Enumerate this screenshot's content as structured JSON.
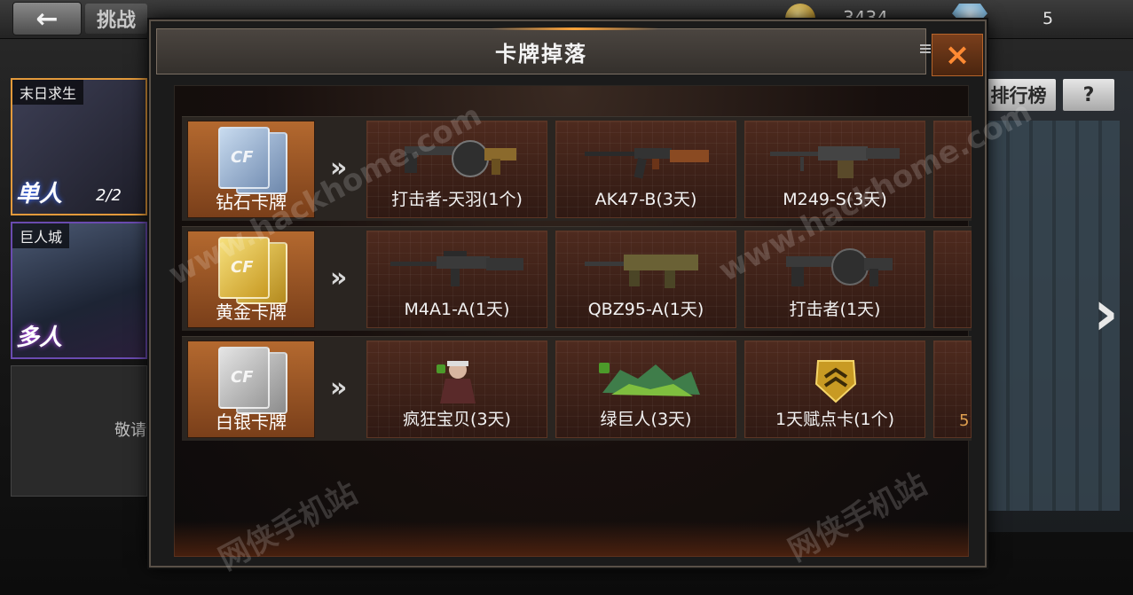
{
  "topbar": {
    "back_icon": "←",
    "challenge_label": "挑战",
    "gold_value": "3434",
    "gem_value": "5"
  },
  "left": {
    "modes": [
      {
        "tag": "末日求生",
        "big": "单人",
        "count": "2/2"
      },
      {
        "tag": "巨人城",
        "big": "多人"
      },
      {
        "hint": "敬请"
      }
    ]
  },
  "right": {
    "rank_label": "排行榜",
    "help_label": "?",
    "next_icon": "›"
  },
  "dialog": {
    "title": "卡牌掉落",
    "close_label": "×",
    "rows": [
      {
        "card_label": "钻石卡牌",
        "card_color": "#9fb8d8",
        "arrow": "»",
        "items": [
          "打击者-天羽(1个)",
          "AK47-B(3天)",
          "M249-S(3天)"
        ]
      },
      {
        "card_label": "黄金卡牌",
        "card_color": "#e7c24a",
        "arrow": "»",
        "items": [
          "M4A1-A(1天)",
          "QBZ95-A(1天)",
          "打击者(1天)"
        ]
      },
      {
        "card_label": "白银卡牌",
        "card_color": "#c8c8c8",
        "arrow": "»",
        "items": [
          "疯狂宝贝(3天)",
          "绿巨人(3天)",
          "1天赋点卡(1个)"
        ],
        "partial": "5"
      }
    ]
  },
  "watermarks": [
    "www.hackhome.com",
    "www.hackhome.com",
    "网侠手机站",
    "网侠手机站"
  ],
  "colors": {
    "accent_orange": "#ff8a33",
    "slot_border": "#5b3524"
  }
}
